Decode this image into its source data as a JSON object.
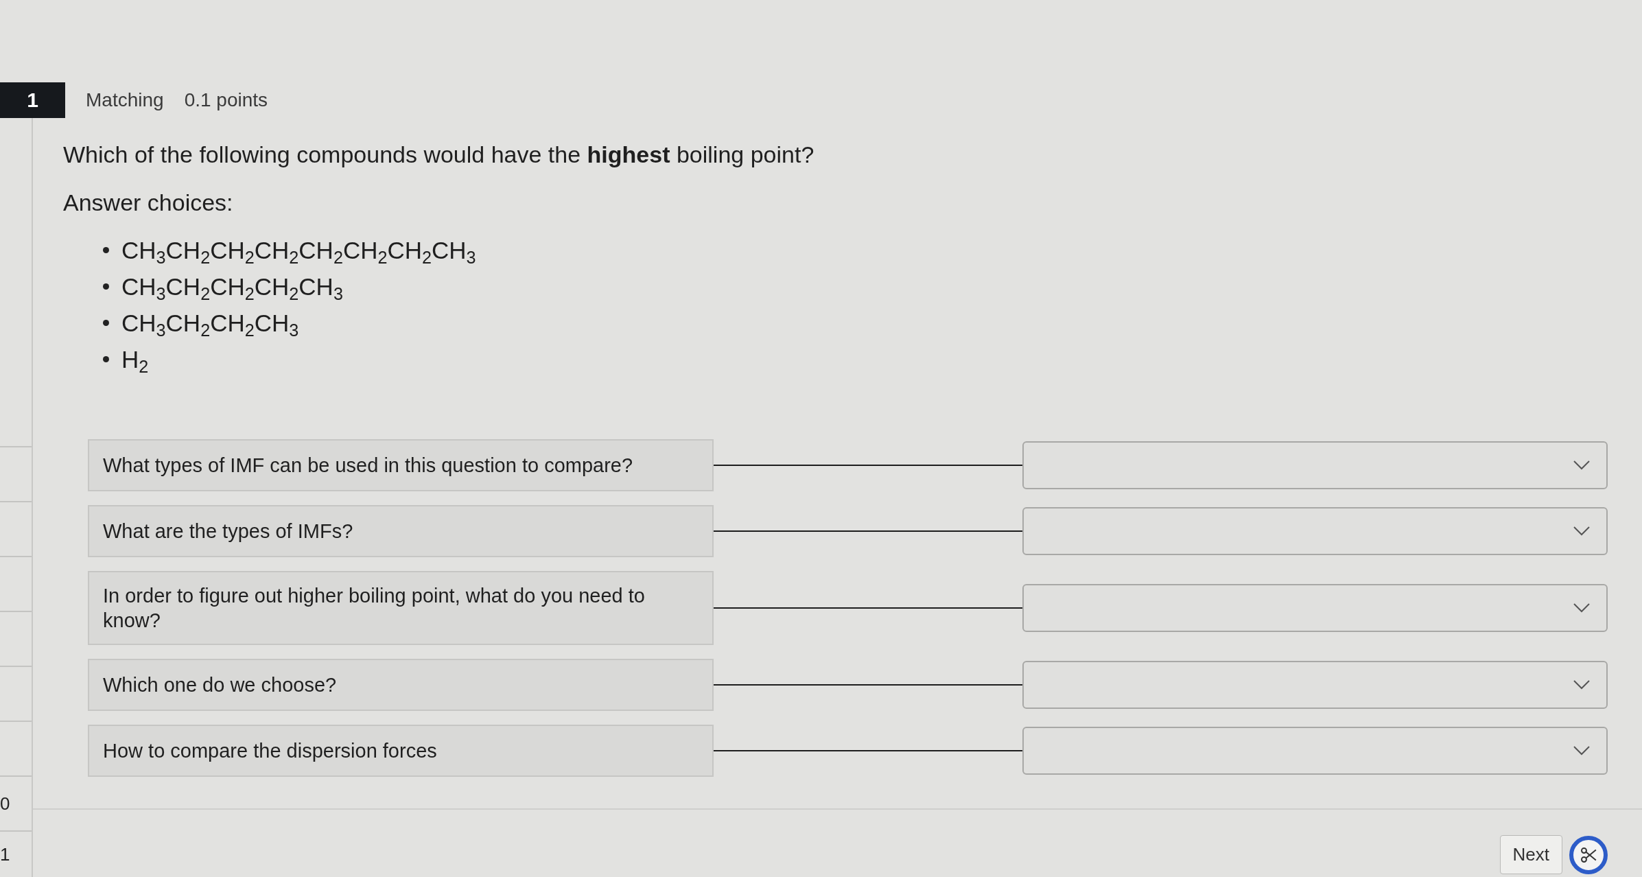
{
  "sidebar": {
    "question_numbers": [
      "0",
      "1"
    ]
  },
  "question": {
    "number": "1",
    "type": "Matching",
    "points": "0.1 points",
    "prompt": "Which of the following compounds would have the **highest** boiling point?",
    "choices_label": "Answer choices:",
    "choices": [
      "CH$_{3}$CH$_{2}$CH$_{2}$CH$_{2}$CH$_{2}$CH$_{2}$CH$_{2}$CH$_{3}$",
      "CH$_{3}$CH$_{2}$CH$_{2}$CH$_{2}$CH$_{3}$",
      "CH$_{3}$CH$_{2}$CH$_{2}$CH$_{3}$",
      "H$_{2}$"
    ]
  },
  "matching": {
    "pairs": [
      {
        "prompt": "What types of IMF can be used in this question to compare?"
      },
      {
        "prompt": "What are the types of IMFs?"
      },
      {
        "prompt": "In order to figure out higher boiling point, what do you need to know?"
      },
      {
        "prompt": "Which one do we choose?"
      },
      {
        "prompt": "How to compare the dispersion forces"
      }
    ]
  },
  "footer": {
    "buttons": [
      "Next"
    ]
  }
}
